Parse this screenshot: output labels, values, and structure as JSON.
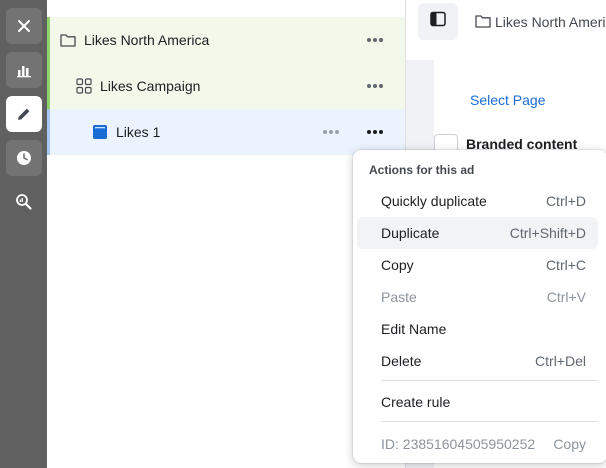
{
  "rail": {
    "buttons": [
      {
        "name": "close",
        "icon": "close-icon"
      },
      {
        "name": "charts",
        "icon": "bar-chart-icon"
      },
      {
        "name": "edit",
        "icon": "pencil-icon"
      },
      {
        "name": "history",
        "icon": "clock-icon"
      },
      {
        "name": "review",
        "icon": "magnify-chart-icon"
      }
    ]
  },
  "tree": {
    "campaign_group": {
      "label": "Likes North America",
      "icon": "folder-icon"
    },
    "campaign": {
      "label": "Likes Campaign",
      "icon": "grid-icon"
    },
    "ad": {
      "label": "Likes 1",
      "icon": "ad-square-icon"
    }
  },
  "right_panel": {
    "breadcrumb": "Likes North America",
    "select_page": "Select Page",
    "branded_content": "Branded content"
  },
  "context_menu": {
    "heading": "Actions for this ad",
    "items": [
      {
        "label": "Quickly duplicate",
        "shortcut": "Ctrl+D"
      },
      {
        "label": "Duplicate",
        "shortcut": "Ctrl+Shift+D"
      },
      {
        "label": "Copy",
        "shortcut": "Ctrl+C"
      },
      {
        "label": "Paste",
        "shortcut": "Ctrl+V"
      },
      {
        "label": "Edit Name",
        "shortcut": ""
      },
      {
        "label": "Delete",
        "shortcut": "Ctrl+Del"
      },
      {
        "label": "Create rule",
        "shortcut": ""
      }
    ],
    "id_text": "ID: 23851604505950252",
    "id_copy": "Copy"
  },
  "colors": {
    "rail": "#606060",
    "tree_green": "#f2f9ea",
    "tree_blue": "#ebf3fe",
    "accent_green": "#8fd46b",
    "link_blue": "#1a6dd6"
  }
}
